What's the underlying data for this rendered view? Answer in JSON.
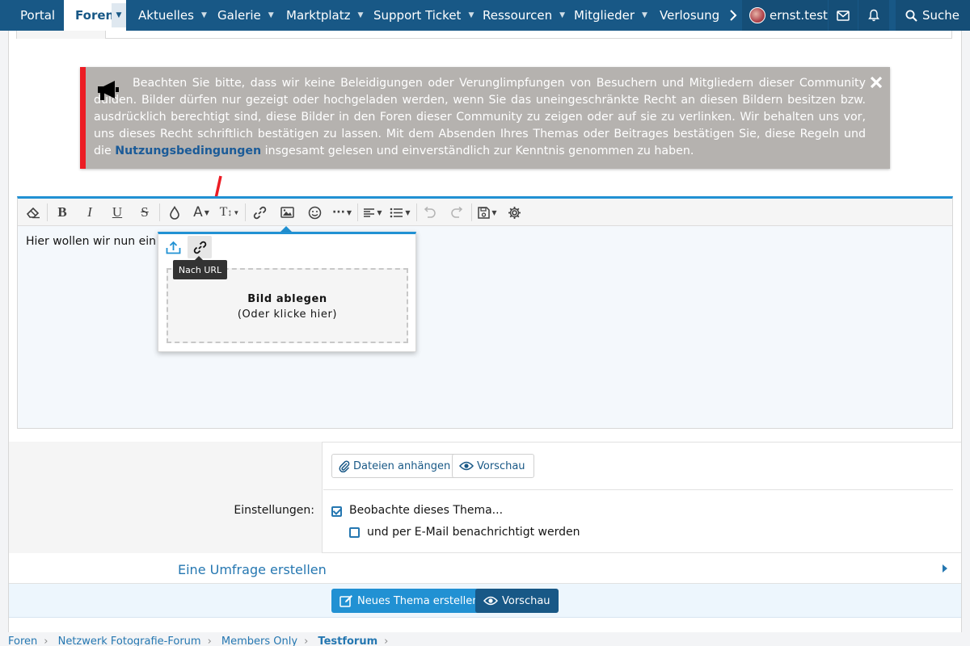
{
  "nav": {
    "items": [
      {
        "label": "Portal"
      },
      {
        "label": "Foren"
      },
      {
        "label": "Aktuelles"
      },
      {
        "label": "Galerie"
      },
      {
        "label": "Marktplatz"
      },
      {
        "label": "Support Ticket"
      },
      {
        "label": "Ressourcen"
      },
      {
        "label": "Mitglieder"
      },
      {
        "label": "Verlosungen"
      }
    ],
    "username": "ernst.test",
    "search_label": "Suche"
  },
  "notice": {
    "text": "Beachten Sie bitte, dass wir keine Beleidigungen oder Verunglimpfungen von Besuchern und Mitgliedern dieser Community dulden. Bilder dürfen nur gezeigt oder hochgeladen werden, wenn Sie das uneingeschränkte Recht an diesen Bildern besitzen bzw. ausdrücklich berechtigt sind, diese Bilder in den Foren dieser Community zu zeigen oder auf sie zu verlinken. Wir behalten uns vor, uns dieses Recht schriftlich bestätigen zu lassen. Mit dem Absenden Ihres Themas oder Beitrages bestätigen Sie, diese Regeln und die",
    "link": "Nutzungsbedingungen",
    "text_after": "insgesamt gelesen und einverständlich zur Kenntnis genommen zu haben."
  },
  "editor": {
    "content": "Hier wollen wir nun ein B"
  },
  "image_popup": {
    "tooltip": "Nach URL",
    "drop_title": "Bild ablegen",
    "drop_sub": "(Oder klicke hier)"
  },
  "form": {
    "attach_label": "Dateien anhängen",
    "preview_label": "Vorschau",
    "settings_label": "Einstellungen:",
    "watch_label": "Beobachte dieses Thema...",
    "watch_checked": true,
    "email_label": "und per E-Mail benachrichtigt werden",
    "email_checked": false,
    "poll_label": "Eine Umfrage erstellen",
    "submit_label": "Neues Thema erstellen",
    "submit_preview_label": "Vorschau"
  },
  "breadcrumb": [
    "Foren",
    "Netzwerk Fotografie-Forum",
    "Members Only",
    "Testforum"
  ],
  "colors": {
    "nav_bg": "#185886",
    "accent": "#2191d3",
    "notice_border": "#ec1c24",
    "annotation_arrow": "#ec1c24"
  }
}
